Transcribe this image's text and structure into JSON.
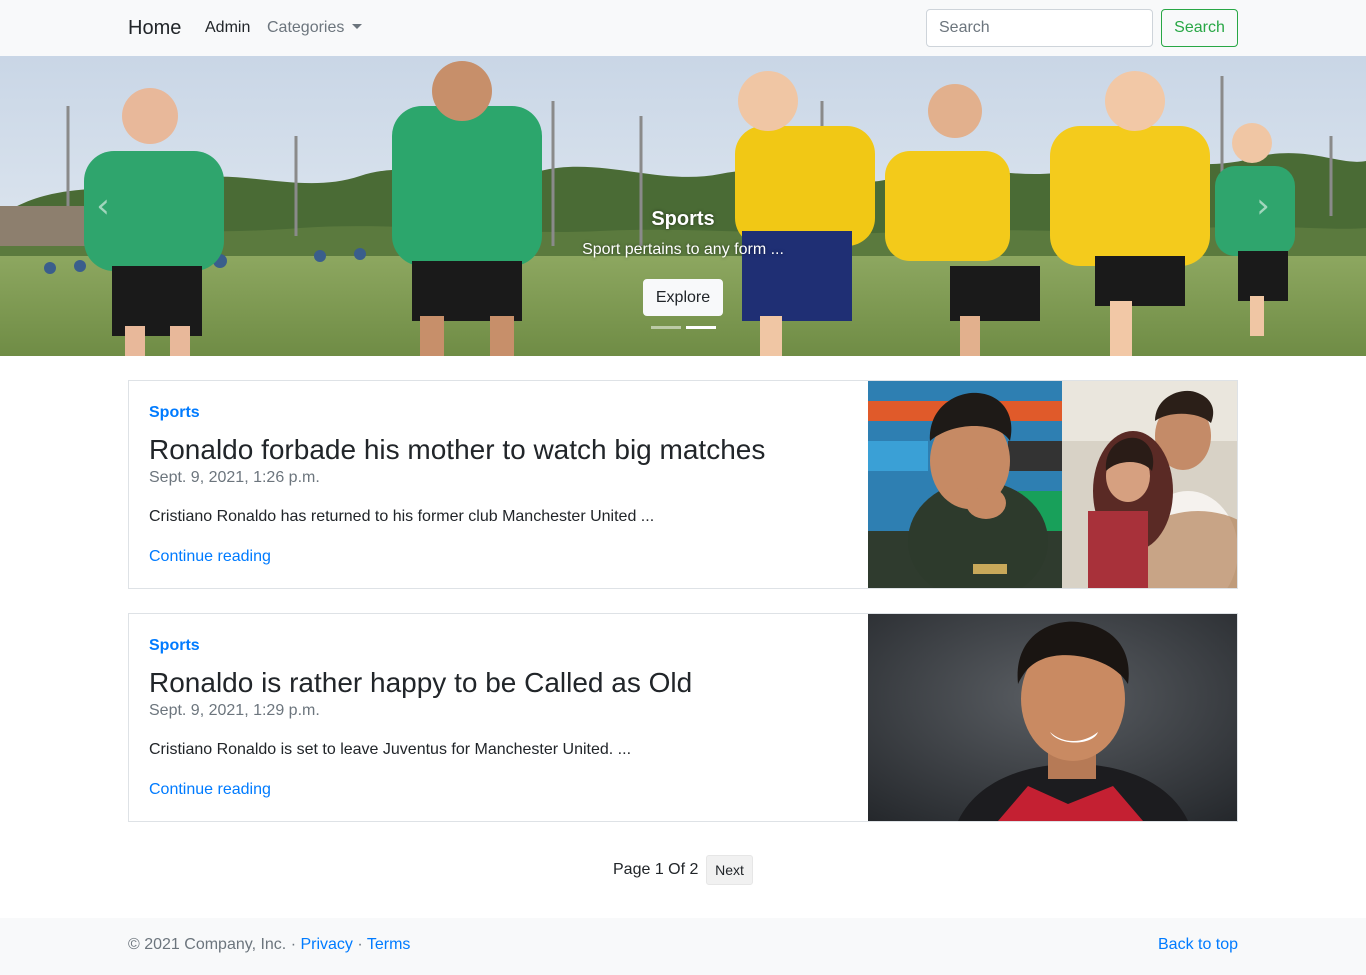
{
  "navbar": {
    "brand": "Home",
    "admin": "Admin",
    "categories": "Categories",
    "search_placeholder": "Search",
    "search_button": "Search"
  },
  "carousel": {
    "title": "Sports",
    "text": "Sport pertains to any form ...",
    "button": "Explore",
    "prev_icon": "‹",
    "next_icon": "›",
    "slides": 2,
    "active_slide": 2
  },
  "posts": [
    {
      "category": "Sports",
      "title": "Ronaldo forbade his mother to watch big matches",
      "date": "Sept. 9, 2021, 1:26 p.m.",
      "excerpt": "Cristiano Ronaldo has returned to his former club Manchester United ...",
      "link": "Continue reading"
    },
    {
      "category": "Sports",
      "title": "Ronaldo is rather happy to be Called as Old",
      "date": "Sept. 9, 2021, 1:29 p.m.",
      "excerpt": "Cristiano Ronaldo is set to leave Juventus for Manchester United. ...",
      "link": "Continue reading"
    }
  ],
  "pagination": {
    "info": "Page 1 Of 2",
    "next": "Next"
  },
  "footer": {
    "copyright": "© 2021 Company, Inc. ·",
    "privacy": "Privacy",
    "separator": "·",
    "terms": "Terms",
    "back_to_top": "Back to top"
  },
  "colors": {
    "link": "#007bff",
    "success": "#28a745",
    "navbar_bg": "#f8f9fa",
    "muted": "#6c757d"
  }
}
